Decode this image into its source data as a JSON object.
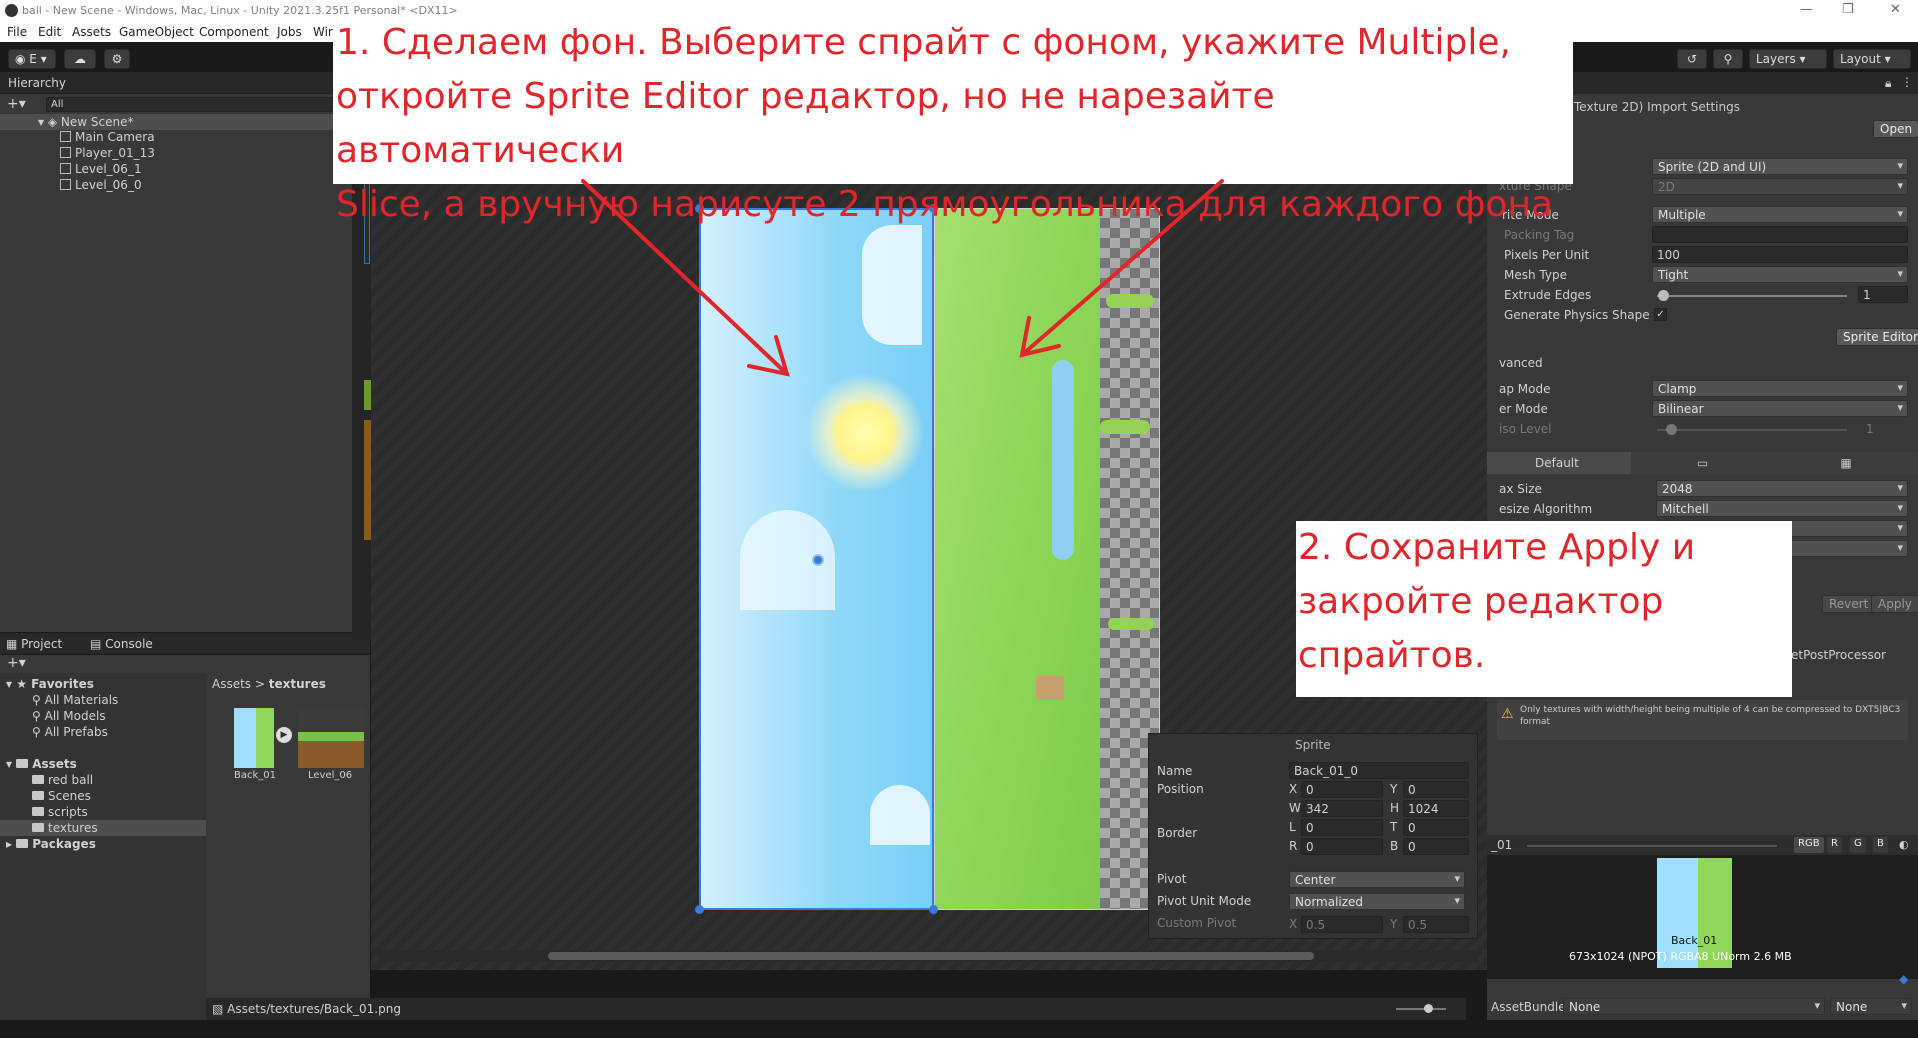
{
  "titlebar": {
    "title": "ball - New Scene - Windows, Mac, Linux - Unity 2021.3.25f1 Personal* <DX11>"
  },
  "menu": [
    "File",
    "Edit",
    "Assets",
    "GameObject",
    "Component",
    "Jobs",
    "Wir"
  ],
  "toolbar": {
    "account": "E",
    "layers": "Layers",
    "layout": "Layout"
  },
  "hierarchy": {
    "tab": "Hierarchy",
    "search_placeholder": "All",
    "scene": "New Scene*",
    "items": [
      "Main Camera",
      "Player_01_13",
      "Level_06_1",
      "Level_06_0"
    ]
  },
  "project": {
    "tab_project": "Project",
    "tab_console": "Console",
    "favorites": "Favorites",
    "favorite_items": [
      "All Materials",
      "All Models",
      "All Prefabs"
    ],
    "assets": "Assets",
    "asset_folders": [
      "red ball",
      "Scenes",
      "scripts",
      "textures"
    ],
    "packages": "Packages",
    "breadcrumb_root": "Assets",
    "breadcrumb_current": "textures",
    "thumbs": [
      "Back_01",
      "Level_06"
    ],
    "path": "Assets/textures/Back_01.png"
  },
  "inspector": {
    "title": "Texture 2D) Import Settings",
    "open": "Open",
    "texture_type": "Sprite (2D and UI)",
    "texture_shape_label": "xture Shape",
    "texture_shape": "2D",
    "sprite_mode_label": "rite Mode",
    "sprite_mode": "Multiple",
    "packing_tag_label": "Packing Tag",
    "ppu_label": "Pixels Per Unit",
    "ppu": "100",
    "mesh_type_label": "Mesh Type",
    "mesh_type": "Tight",
    "extrude_label": "Extrude Edges",
    "extrude": "1",
    "physics_label": "Generate Physics Shape",
    "sprite_editor": "Sprite Editor",
    "advanced": "vanced",
    "wrap_label": "ap Mode",
    "wrap": "Clamp",
    "filter_label": "er Mode",
    "filter": "Bilinear",
    "aniso_label": "iso Level",
    "aniso": "1",
    "platform_default": "Default",
    "max_size_label": "ax Size",
    "max_size": "2048",
    "resize_label": "esize Algorithm",
    "resize": "Mitchell",
    "revert": "Revert",
    "apply": "Apply",
    "postprocessor": "etPostProcessor",
    "warning": "Only textures with width/height being multiple of 4 can be compressed to DXT5|BC3 format",
    "preview_name": "_01",
    "channels": [
      "RGB",
      "R",
      "G",
      "B"
    ],
    "preview_label": "Back_01",
    "preview_info": "673x1024 (NPOT)  RGBA8 UNorm  2.6 MB",
    "assetbundle_label": "AssetBundle",
    "assetbundle": "None",
    "assetbundle_variant": "None"
  },
  "sprite_panel": {
    "title": "Sprite",
    "name_label": "Name",
    "name": "Back_01_0",
    "position_label": "Position",
    "x": "0",
    "y": "0",
    "w": "342",
    "h": "1024",
    "border_label": "Border",
    "l": "0",
    "t": "0",
    "r": "0",
    "b": "0",
    "pivot_label": "Pivot",
    "pivot": "Center",
    "pivot_unit_label": "Pivot Unit Mode",
    "pivot_unit": "Normalized",
    "custom_pivot_label": "Custom Pivot",
    "cx": "0.5",
    "cy": "0.5",
    "letters": {
      "x": "X",
      "y": "Y",
      "w": "W",
      "h": "H",
      "l": "L",
      "t": "T",
      "r": "R",
      "b": "B"
    }
  },
  "annotations": {
    "step1": [
      "1. Сделаем фон. Выберите спрайт с фоном, укажите Multiple,",
      "откройте Sprite Editor редактор,  но не нарезайте автоматически",
      "Slice, а вручную нарисуте 2 прямоугольника для каждого фона"
    ],
    "step2": [
      "2. Сохраните Apply и",
      "закройте редактор",
      "спрайтов."
    ]
  },
  "colors": {
    "annotation_red": "#e0262a",
    "sky": "#8fd8f8",
    "grass": "#8fd65a"
  }
}
